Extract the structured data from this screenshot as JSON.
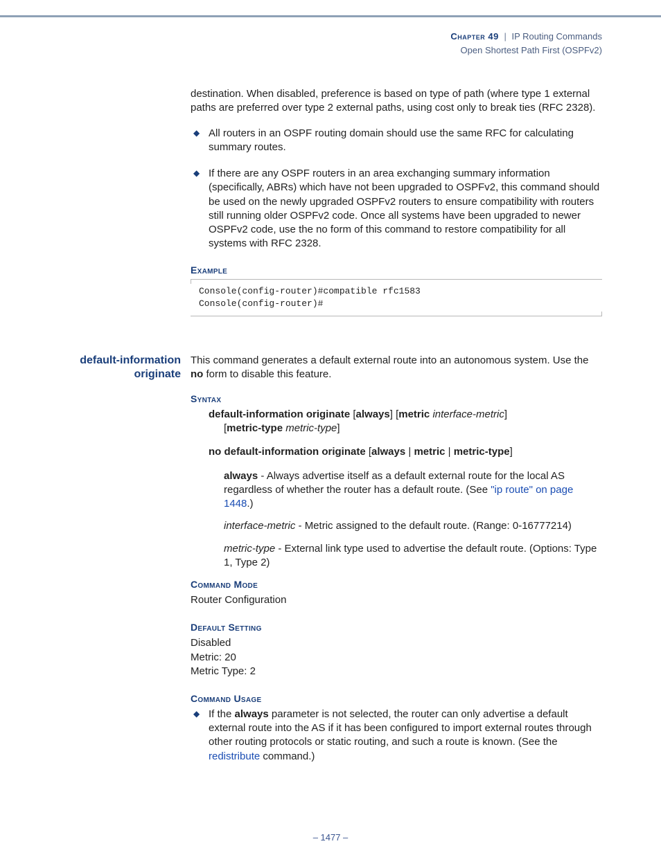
{
  "header": {
    "chapter": "Chapter 49",
    "sep": "|",
    "title": "IP Routing Commands",
    "subtitle": "Open Shortest Path First (OSPFv2)"
  },
  "intro_para": "destination. When disabled, preference is based on type of path (where type 1 external paths are preferred over type 2 external paths, using cost only to break ties (RFC 2328).",
  "bullets_top": [
    "All routers in an OSPF routing domain should use the same RFC for calculating summary routes.",
    "If there are any OSPF routers in an area exchanging summary information (specifically, ABRs) which have not been upgraded to OSPFv2, this command should be used on the newly upgraded OSPFv2 routers to ensure compatibility with routers still running older OSPFv2 code. Once all systems have been upgraded to newer OSPFv2 code, use the no form of this command to restore compatibility for all systems with RFC 2328."
  ],
  "labels": {
    "example": "Example",
    "syntax": "Syntax",
    "command_mode": "Command Mode",
    "default_setting": "Default Setting",
    "command_usage": "Command Usage"
  },
  "example_code": "Console(config-router)#compatible rfc1583\nConsole(config-router)#",
  "command": {
    "name_line1": "default-information",
    "name_line2": "originate",
    "desc_pre": "This command generates a default external route into an autonomous system. Use the ",
    "desc_bold": "no",
    "desc_post": " form to disable this feature."
  },
  "syntax": {
    "line1": {
      "cmd": "default-information originate",
      "opt1": "always",
      "opt2_kw": "metric",
      "opt2_it": "interface-metric",
      "opt3_kw": "metric-type",
      "opt3_it": "metric-type"
    },
    "line2": {
      "cmd": "no default-information originate",
      "o1": "always",
      "o2": "metric",
      "o3": "metric-type"
    }
  },
  "params": {
    "always": {
      "kw": "always",
      "txt_pre": " - Always advertise itself as a default external route for the local AS regardless of whether the router has a default route. (See ",
      "link": "\"ip route\" on page 1448",
      "txt_post": ".)"
    },
    "interface_metric": {
      "it": "interface-metric",
      "txt": " - Metric assigned to the default route. (Range: 0-16777214)"
    },
    "metric_type": {
      "it": "metric-type",
      "txt": " - External link type used to advertise the default route. (Options: Type 1, Type 2)"
    }
  },
  "command_mode_val": "Router Configuration",
  "default_setting_vals": [
    "Disabled",
    "Metric: 20",
    "Metric Type: 2"
  ],
  "usage_bullet": {
    "pre": "If the ",
    "bold": "always",
    "mid": " parameter is not selected, the router can only advertise a default external route into the AS if it has been configured to import external routes through other routing protocols or static routing, and such a route is known. (See the ",
    "link": "redistribute",
    "post": " command.)"
  },
  "pagenum": "–  1477  –"
}
